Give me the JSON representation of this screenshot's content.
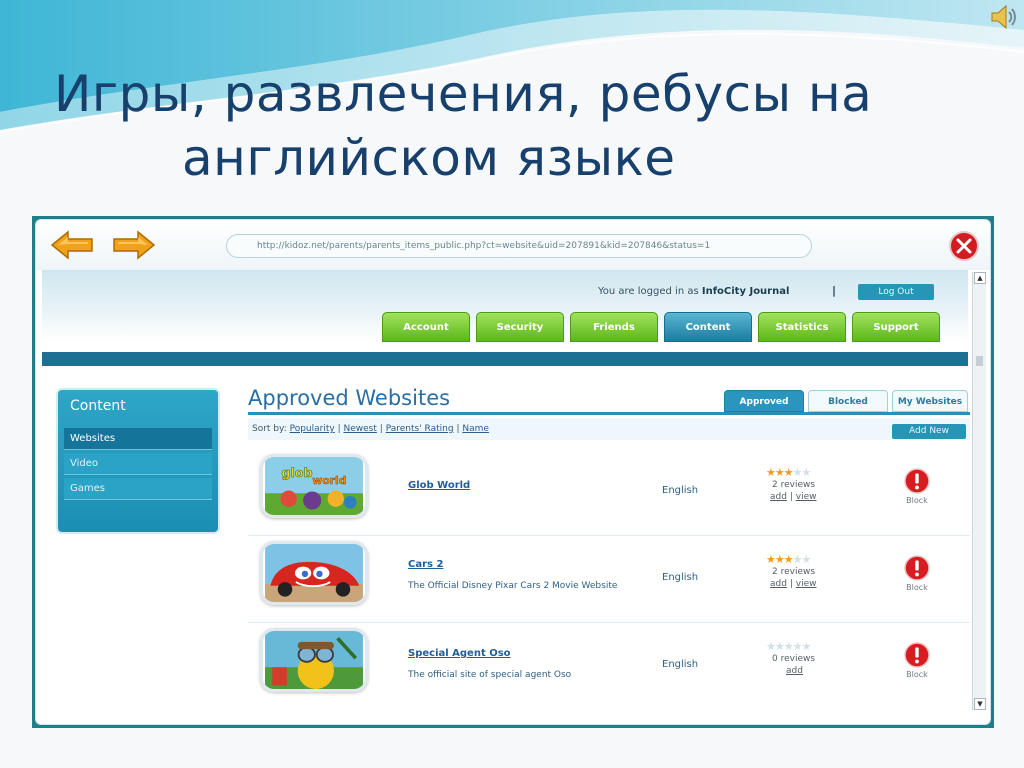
{
  "slide": {
    "title_line1": "Игры, развлечения, ребусы на",
    "title_line2": "английском языке"
  },
  "browser": {
    "url": "http://kidoz.net/parents/parents_items_public.php?ct=website&uid=207891&kid=207846&status=1"
  },
  "header": {
    "login_prefix": "You are logged in as",
    "username": "InfoCity Journal",
    "separator": "|",
    "logout_label": "Log Out",
    "tabs": [
      "Account",
      "Security",
      "Friends",
      "Content",
      "Statistics",
      "Support"
    ],
    "active_tab": "Content"
  },
  "sidebar": {
    "title": "Content",
    "items": [
      "Websites",
      "Video",
      "Games"
    ],
    "selected": "Websites"
  },
  "content": {
    "title": "Approved Websites",
    "subtabs": [
      "Approved",
      "Blocked",
      "My Websites"
    ],
    "active_subtab": "Approved",
    "sort_label": "Sort by:",
    "sort_options": [
      "Popularity",
      "Newest",
      "Parents' Rating",
      "Name"
    ],
    "sort_sep": "|",
    "add_new_label": "Add New",
    "link_sep": "|",
    "rows": [
      {
        "title": "Glob World",
        "description": "",
        "language": "English",
        "rating": 3,
        "max_rating": 5,
        "reviews": "2 reviews",
        "add_label": "add",
        "view_label": "view",
        "block_label": "Block"
      },
      {
        "title": "Cars 2",
        "description": "The Official Disney Pixar Cars 2 Movie Website",
        "language": "English",
        "rating": 3,
        "max_rating": 5,
        "reviews": "2 reviews",
        "add_label": "add",
        "view_label": "view",
        "block_label": "Block"
      },
      {
        "title": "Special Agent Oso",
        "description": "The official site of special agent Oso",
        "language": "English",
        "rating": 0,
        "max_rating": 5,
        "reviews": "0 reviews",
        "add_label": "add",
        "view_label": "",
        "block_label": "Block"
      }
    ]
  },
  "colors": {
    "title_blue": "#17406d",
    "tab_green": "#5cb71c",
    "tab_active": "#1c7da0",
    "star_on": "#f39a1f",
    "block_red": "#d81d22"
  }
}
